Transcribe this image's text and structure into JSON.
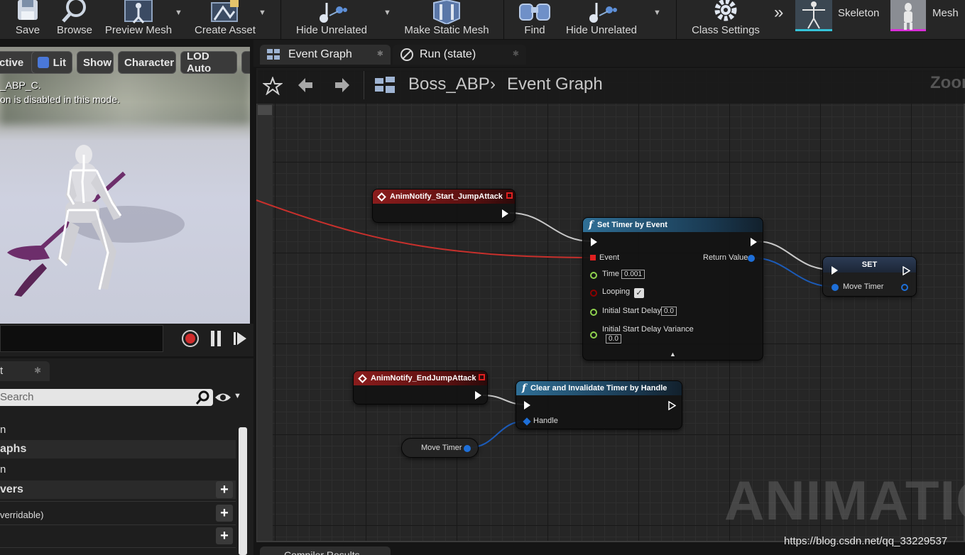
{
  "toolbar": {
    "save": "Save",
    "browse": "Browse",
    "preview_mesh": "Preview Mesh",
    "create_asset": "Create Asset",
    "hide_unrelated_1": "Hide Unrelated",
    "make_static_mesh": "Make Static Mesh",
    "find": "Find",
    "hide_unrelated_2": "Hide Unrelated",
    "class_settings": "Class Settings",
    "skeleton": "Skeleton",
    "mesh": "Mesh"
  },
  "viewport": {
    "btn_active": "ctive",
    "btn_lit": "Lit",
    "btn_show": "Show",
    "btn_character": "Character",
    "btn_lod": "LOD Auto",
    "info_line1": "_ABP_C.",
    "info_line2": "on is disabled in this mode."
  },
  "left_panel": {
    "tab_label": "t",
    "search_placeholder": "Search",
    "rows": [
      "n",
      "aphs",
      "n",
      "vers",
      "verridable)"
    ]
  },
  "doc_tabs": {
    "event_graph": "Event Graph",
    "run_state": "Run (state)"
  },
  "breadcrumb": {
    "asset": "Boss_ABP",
    "graph": "Event Graph",
    "zoom": "Zoom"
  },
  "nodes": {
    "notify_start": {
      "title": "AnimNotify_Start_JumpAttack"
    },
    "set_timer": {
      "title": "Set Timer by Event",
      "event": "Event",
      "return_value": "Return Value",
      "time": "Time",
      "time_value": "0.001",
      "looping": "Looping",
      "initial_start_delay": "Initial Start Delay",
      "initial_start_delay_value": "0.0",
      "initial_start_delay_variance": "Initial Start Delay Variance",
      "initial_start_delay_variance_value": "0.0"
    },
    "set_var": {
      "title": "SET",
      "move_timer": "Move Timer"
    },
    "notify_end": {
      "title": "AnimNotify_EndJumpAttack"
    },
    "clear_timer": {
      "title": "Clear and Invalidate Timer by Handle",
      "handle": "Handle"
    },
    "get_var": {
      "move_timer": "Move Timer"
    }
  },
  "bottom_tab": "Compiler Results",
  "watermark": "ANIMATION",
  "source_url": "https://blog.csdn.net/qq_33229537",
  "colors": {
    "exec": "#ffffff",
    "event_pin": "#e02020",
    "float_pin": "#8fd14f",
    "bool_pin": "#8b0000",
    "struct_pin": "#1e6fd8",
    "red_wire": "#c8302c",
    "blue_wire": "#1c5bb8",
    "white_wire": "#c8c8c8"
  }
}
